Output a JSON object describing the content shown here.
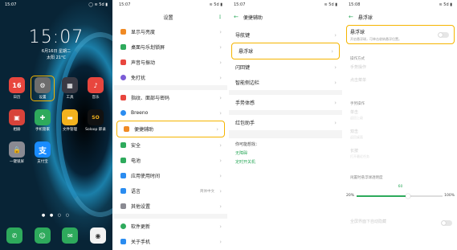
{
  "home": {
    "status_time": "15:07",
    "status_icons": "◯ ≋ 5d ▮",
    "clock": "15:07",
    "date": "6月16日 星期二",
    "weather": "太阳 21°C",
    "apps": [
      {
        "label": "日历",
        "num": "16"
      },
      {
        "label": "设置"
      },
      {
        "label": "工具"
      },
      {
        "label": "音乐"
      },
      {
        "label": "相册"
      },
      {
        "label": "手机管家"
      },
      {
        "label": "文件管理"
      },
      {
        "label": "Soloop 即录"
      },
      {
        "label": "一键锁屏"
      },
      {
        "label": "支付宝"
      }
    ],
    "page_dots": "● ● ○ ○"
  },
  "settings": {
    "status_time": "15:07",
    "status_icons": "≋ 5d ▮",
    "title": "设置",
    "more": "⋮",
    "items": [
      {
        "label": "显示与亮度"
      },
      {
        "label": "桌面与乐划锁屏"
      },
      {
        "label": "声音与振动"
      },
      {
        "label": "免打扰"
      },
      {
        "label": "指纹、面部与密码"
      },
      {
        "label": "Breeno"
      },
      {
        "label": "便捷辅助"
      },
      {
        "label": "安全"
      },
      {
        "label": "电池"
      },
      {
        "label": "应用使用时间"
      },
      {
        "label": "语言",
        "value": "简体中文"
      },
      {
        "label": "其他设置"
      },
      {
        "label": "软件更新"
      },
      {
        "label": "关于手机"
      }
    ]
  },
  "assist": {
    "status_time": "15:07",
    "status_icons": "≋ 5d ▮",
    "title": "便捷辅助",
    "items": [
      {
        "label": "导航键"
      },
      {
        "label": "悬浮球"
      },
      {
        "label": "闪回键"
      },
      {
        "label": "智能侧边栏"
      },
      {
        "label": "手势体感"
      },
      {
        "label": "红包助手"
      }
    ],
    "section": "你可能想找：",
    "links": [
      "无障碍",
      "定时开关机"
    ]
  },
  "float": {
    "status_time": "15:08",
    "status_icons": "≋ 5d ▮",
    "title": "悬浮球",
    "toggle_title": "悬浮球",
    "toggle_desc": "开启悬浮球，可单击收纳悬浮位置。",
    "sec1": "操作方式",
    "mode1": "手势操作",
    "mode2": "点击菜单",
    "sec2": "手势操作",
    "g1_t": "单击",
    "g1_s": "返回上级",
    "g2_t": "双击",
    "g2_s": "返回桌面",
    "g3_t": "长按",
    "g3_s": "打开最近任务",
    "opacity_label": "闲置时悬浮球透明度",
    "opacity_value": "60",
    "opacity_min": "20%",
    "opacity_max": "100%",
    "opacity_fraction": 0.6,
    "bottom_t": "全屏界面下自动隐藏"
  }
}
